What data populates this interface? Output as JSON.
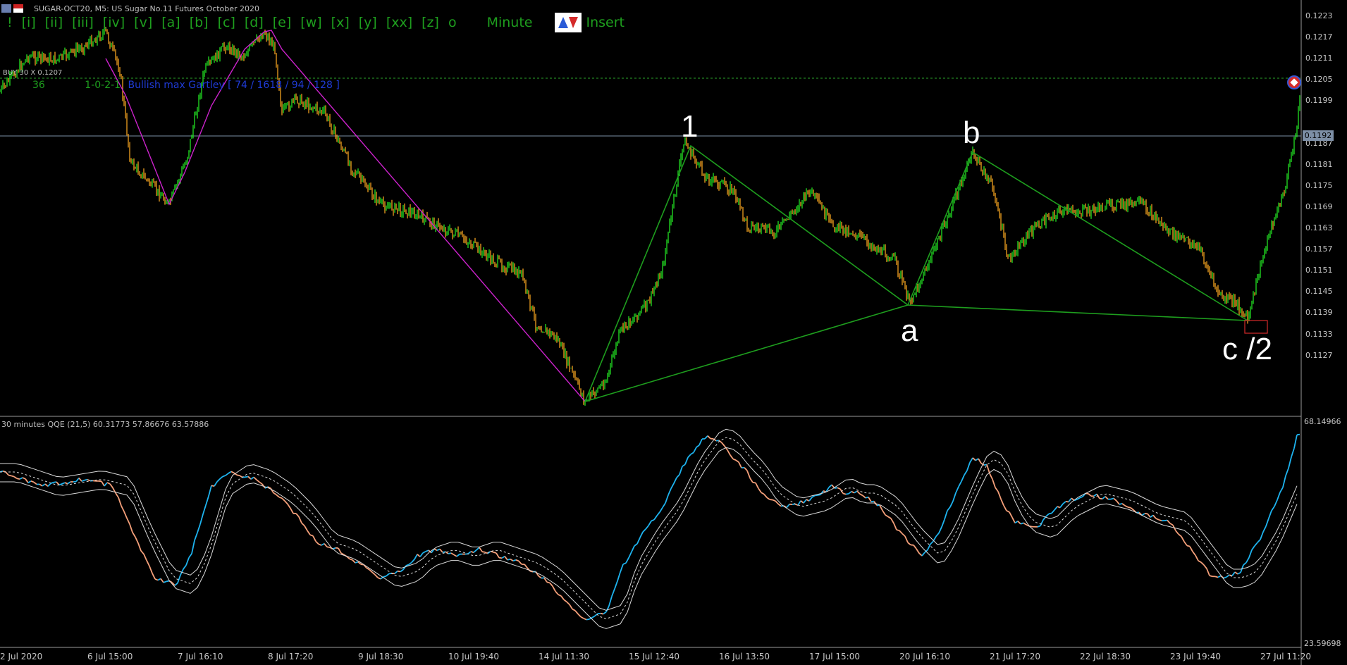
{
  "window": {
    "title": "SUGAR-OCT20, M5:  US Sugar No.11 Futures October 2020"
  },
  "toolbar": {
    "waves": [
      "!",
      "[i]",
      "[ii]",
      "[iii]",
      "[iv]",
      "[v]",
      "[a]",
      "[b]",
      "[c]",
      "[d]",
      "[e]",
      "[w]",
      "[x]",
      "[y]",
      "[xx]",
      "[z]",
      "o"
    ],
    "timeframe": "Minute",
    "insert": "Insert"
  },
  "info": {
    "text": "BUY 30 X 0.1207",
    "count": "36",
    "ratio": "1-0-2-1",
    "description": "Bullish max Gartley [ 74 / 1618 / 94 / 128 ]"
  },
  "indicator": {
    "title": "30 minutes QQE (21,5) 60.31773 57.86676 63.57886",
    "max_label": "68.14966",
    "min_label": "23.59698"
  },
  "price_axis": {
    "labels": [
      "0.1223",
      "0.1217",
      "0.1211",
      "0.1205",
      "0.1199",
      "0.1192",
      "0.1187",
      "0.1181",
      "0.1175",
      "0.1169",
      "0.1163",
      "0.1157",
      "0.1151",
      "0.1145",
      "0.1139",
      "0.1133",
      "0.1127"
    ],
    "current_price": "0.1192"
  },
  "time_axis": {
    "labels": [
      "2 Jul 2020",
      "6 Jul 15:00",
      "7 Jul 16:10",
      "8 Jul 17:20",
      "9 Jul 18:30",
      "10 Jul 19:40",
      "14 Jul 11:30",
      "15 Jul 12:40",
      "16 Jul 13:50",
      "17 Jul 15:00",
      "20 Jul 16:10",
      "21 Jul 17:20",
      "22 Jul 18:30",
      "23 Jul 19:40",
      "27 Jul 11:20"
    ]
  },
  "wave_labels": {
    "one": "1",
    "a": "a",
    "b": "b",
    "c": "c /2"
  },
  "colors": {
    "background": "#000000",
    "bull_candle": "#22e022",
    "bear_candle": "#f0a020",
    "pattern_line": "#1e9e1e",
    "magenta_line": "#cc22cc",
    "qqe_rising": "#1eb4f0",
    "qqe_falling": "#f5a07a"
  }
}
